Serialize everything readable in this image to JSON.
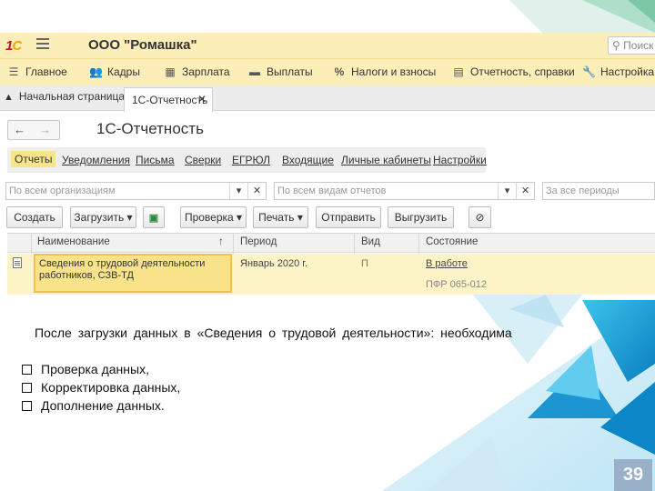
{
  "app": {
    "title": "ООО \"Ромашка\"",
    "search_placeholder": "Поиск"
  },
  "sections": [
    {
      "label": "Главное",
      "icon": "hamburger-icon"
    },
    {
      "label": "Кадры",
      "icon": "people-icon"
    },
    {
      "label": "Зарплата",
      "icon": "calculator-icon"
    },
    {
      "label": "Выплаты",
      "icon": "wallet-icon"
    },
    {
      "label": "Налоги и взносы",
      "icon": "percent-icon"
    },
    {
      "label": "Отчетность, справки",
      "icon": "documents-icon"
    },
    {
      "label": "Настройка",
      "icon": "wrench-icon"
    }
  ],
  "tabs": {
    "home": "Начальная страница",
    "active": "1С-Отчетность"
  },
  "form": {
    "title": "1С-Отчетность"
  },
  "links": [
    {
      "label": "Отчеты",
      "active": true
    },
    {
      "label": "Уведомления",
      "active": false
    },
    {
      "label": "Письма",
      "active": false
    },
    {
      "label": "Сверки",
      "active": false
    },
    {
      "label": "ЕГРЮЛ",
      "active": false
    },
    {
      "label": "Входящие",
      "active": false
    },
    {
      "label": "Личные кабинеты",
      "active": false
    },
    {
      "label": "Настройки",
      "active": false
    }
  ],
  "filters": {
    "organizations_placeholder": "По всем организациям",
    "reports_placeholder": "По всем видам отчетов",
    "period_placeholder": "За все периоды"
  },
  "toolbar": {
    "create": "Создать",
    "upload": "Загрузить",
    "check": "Проверка",
    "print": "Печать",
    "send": "Отправить",
    "export": "Выгрузить"
  },
  "table": {
    "columns": [
      "Наименование",
      "Период",
      "Вид",
      "Состояние"
    ],
    "sort_indicator": "↑",
    "rows": [
      {
        "name": "Сведения о трудовой деятельности работников, СЗВ-ТД",
        "period": "Январь 2020 г.",
        "kind": "П",
        "status": "В работе",
        "recipient": "ПФР 065-012"
      }
    ]
  },
  "notice": {
    "lead": "После загрузки данных в «Сведения о трудовой деятельности»: необходима",
    "items": [
      "Проверка данных,",
      "Корректировка данных,",
      "Дополнение данных."
    ]
  },
  "slide_number": "39",
  "colors": {
    "panel_yellow": "#fbeeb8",
    "row_highlight": "#fcf3c7",
    "selected_cell": "#f8e38b",
    "accent_blue": "#2aa7d8",
    "page_badge": "#9ab0c8"
  }
}
